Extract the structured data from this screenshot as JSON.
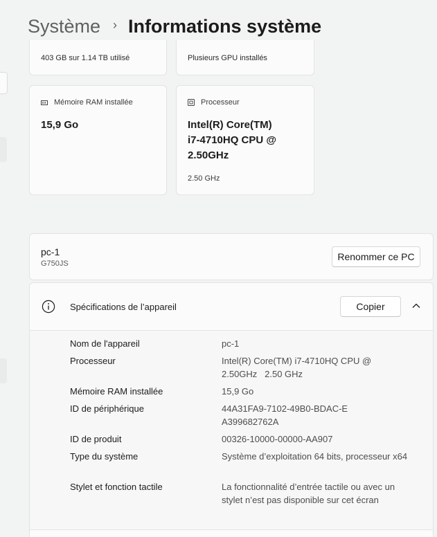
{
  "header": {
    "parent": "Système",
    "separator": "›",
    "current": "Informations système"
  },
  "cards": {
    "storage": {
      "text": "403 GB sur 1.14 TB utilisé"
    },
    "gpu": {
      "text": "Plusieurs GPU installés"
    },
    "ram": {
      "label": "Mémoire RAM installée",
      "value": "15,9 Go",
      "icon": "memory-icon"
    },
    "cpu": {
      "label": "Processeur",
      "value_lines": [
        "Intel(R) Core(TM)",
        "i7-4710HQ CPU @",
        "2.50GHz"
      ],
      "sub": "2.50 GHz",
      "icon": "processor-icon"
    }
  },
  "pc": {
    "name": "pc-1",
    "model": "G750JS",
    "rename_label": "Renommer ce PC"
  },
  "specs": {
    "title": "Spécifications de l’appareil",
    "copy_label": "Copier",
    "rows": [
      {
        "key": "Nom de l'appareil",
        "value": "pc-1"
      },
      {
        "key": "Processeur",
        "value": "Intel(R) Core(TM) i7-4710HQ CPU @ 2.50GHz   2.50 GHz"
      },
      {
        "key": "Mémoire RAM installée",
        "value": "15,9 Go"
      },
      {
        "key": "ID de périphérique",
        "value": "44A31FA9-7102-49B0-BDAC-EA399682762A"
      },
      {
        "key": "ID de produit",
        "value": "00326-10000-00000-AA907"
      },
      {
        "key": "Type du système",
        "value": "Système d’exploitation 64 bits, processeur x64"
      },
      {
        "key": "Stylet et fonction tactile",
        "value": "La fonctionnalité d’entrée tactile ou avec un stylet n’est pas disponible sur cet écran"
      }
    ]
  }
}
